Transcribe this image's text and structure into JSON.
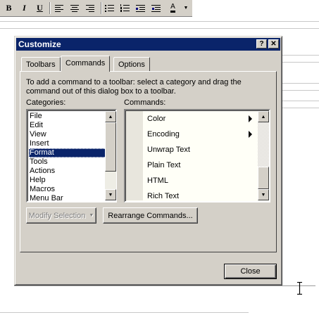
{
  "toolbar": {
    "bold": "B",
    "italic": "I",
    "underline": "U"
  },
  "dialog": {
    "title": "Customize",
    "help_button": "?",
    "close_button": "✕",
    "tabs": [
      "Toolbars",
      "Commands",
      "Options"
    ],
    "active_tab": "Commands",
    "instructions": "To add a command to a toolbar: select a category and drag the command out of this dialog box to a toolbar.",
    "categories_label": "Categories:",
    "commands_label": "Commands:",
    "categories": [
      "File",
      "Edit",
      "View",
      "Insert",
      "Format",
      "Tools",
      "Actions",
      "Help",
      "Macros",
      "Menu Bar"
    ],
    "selected_category": "Format",
    "commands": [
      {
        "label": "Color",
        "submenu": true
      },
      {
        "label": "Encoding",
        "submenu": true
      },
      {
        "label": "Unwrap Text",
        "submenu": false
      },
      {
        "label": "Plain Text",
        "submenu": false
      },
      {
        "label": "HTML",
        "submenu": false
      },
      {
        "label": "Rich Text",
        "submenu": false
      }
    ],
    "modify_selection_label": "Modify Selection",
    "rearrange_label": "Rearrange Commands...",
    "close_label": "Close"
  },
  "colors": {
    "titlebar": "#0a246a",
    "face": "#d4d0c8",
    "selection": "#0a246a"
  }
}
